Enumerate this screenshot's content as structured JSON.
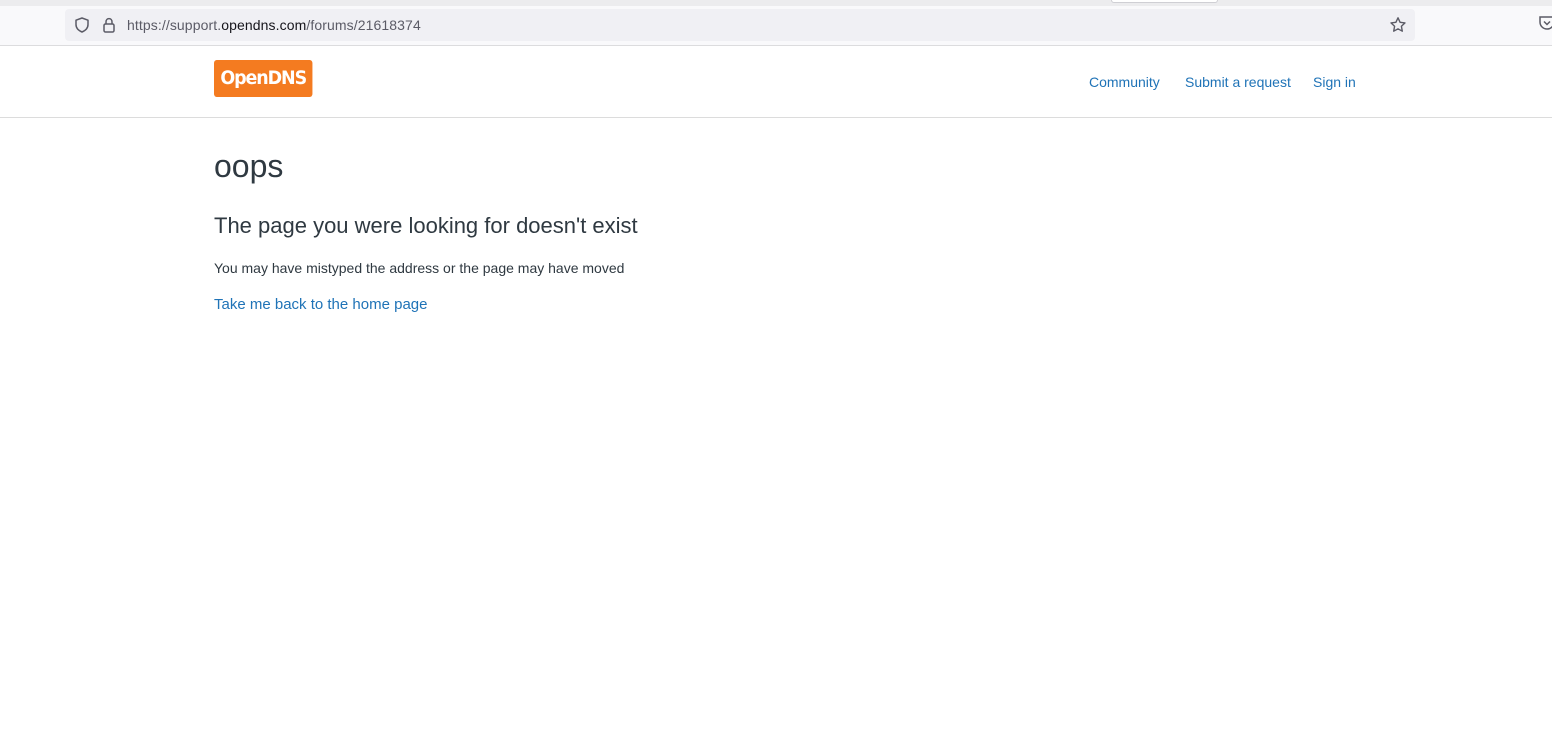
{
  "browser": {
    "url_prefix": "https://support.",
    "url_host": "opendns.com",
    "url_path": "/forums/21618374",
    "icons": [
      "shield-icon",
      "lock-icon",
      "star-icon",
      "pocket-icon"
    ]
  },
  "header": {
    "logo_text": "OpenDNS",
    "logo_color": "#f47b20",
    "nav": {
      "community": "Community",
      "submit_request": "Submit a request",
      "sign_in": "Sign in"
    },
    "link_color": "#1f73b7"
  },
  "main": {
    "title": "oops",
    "subtitle": "The page you were looking for doesn't exist",
    "description": "You may have mistyped the address or the page may have moved",
    "home_link": "Take me back to the home page",
    "text_color": "#2f3941"
  }
}
